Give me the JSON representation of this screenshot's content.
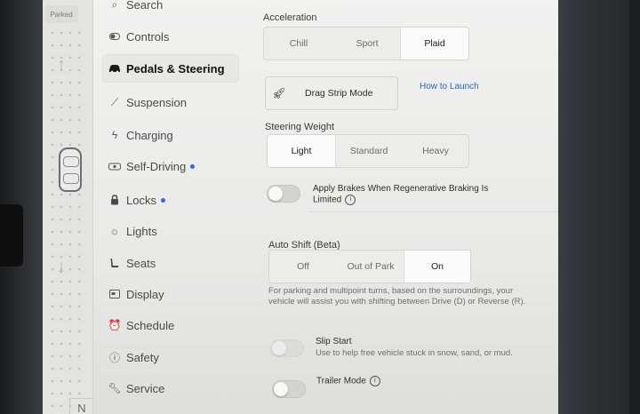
{
  "status_strip": {
    "parked_label": "Parked",
    "gear": "N"
  },
  "menu": {
    "items": [
      {
        "label": "Search",
        "icon": "search-icon"
      },
      {
        "label": "Controls",
        "icon": "toggle-icon"
      },
      {
        "label": "Pedals & Steering",
        "icon": "car-icon",
        "active": true
      },
      {
        "label": "Suspension",
        "icon": "suspension-icon"
      },
      {
        "label": "Charging",
        "icon": "bolt-icon"
      },
      {
        "label": "Self-Driving",
        "icon": "steering-wheel-icon",
        "dot": true
      },
      {
        "label": "Locks",
        "icon": "lock-icon",
        "dot": true
      },
      {
        "label": "Lights",
        "icon": "sun-icon"
      },
      {
        "label": "Seats",
        "icon": "seat-icon"
      },
      {
        "label": "Display",
        "icon": "display-icon"
      },
      {
        "label": "Schedule",
        "icon": "alarm-clock-icon"
      },
      {
        "label": "Safety",
        "icon": "info-circle-icon"
      },
      {
        "label": "Service",
        "icon": "wrench-icon"
      }
    ],
    "dot_color": "#2d6be0"
  },
  "acceleration": {
    "title": "Acceleration",
    "options": [
      "Chill",
      "Sport",
      "Plaid"
    ],
    "selected": "Plaid"
  },
  "drag_strip": {
    "button_label": "Drag Strip Mode",
    "icon": "rocket-icon",
    "link_label": "How to Launch"
  },
  "steering_weight": {
    "title": "Steering Weight",
    "options": [
      "Light",
      "Standard",
      "Heavy"
    ],
    "selected": "Light"
  },
  "apply_brakes": {
    "label": "Apply Brakes When Regenerative Braking Is Limited",
    "enabled": false
  },
  "auto_shift": {
    "title": "Auto Shift (Beta)",
    "options": [
      "Off",
      "Out of Park",
      "On"
    ],
    "selected": "On",
    "description": "For parking and multipoint turns, based on the surroundings, your vehicle will assist you with shifting between Drive (D) or Reverse (R)."
  },
  "slip_start": {
    "label": "Slip Start",
    "description": "Use to help free vehicle stuck in snow, sand, or mud.",
    "enabled": false
  },
  "trailer_mode": {
    "label": "Trailer Mode",
    "enabled": false
  }
}
